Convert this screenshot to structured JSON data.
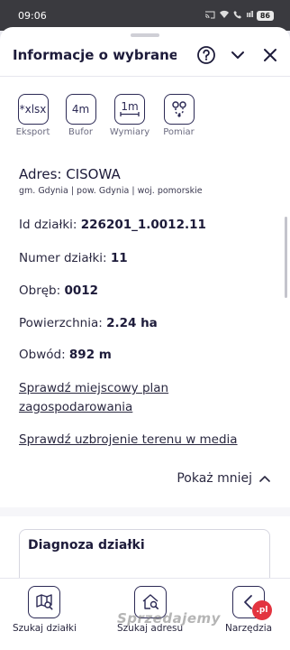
{
  "status_bar": {
    "time": "09:06",
    "battery": "86",
    "network": "ıııll"
  },
  "header": {
    "title": "Informacje o wybranej ..."
  },
  "tools": [
    {
      "glyph": "*xlsx",
      "label": "Eksport"
    },
    {
      "glyph": "4m",
      "label": "Bufor"
    },
    {
      "glyph": "1m",
      "label": "Wymiary"
    },
    {
      "glyph": "",
      "label": "Pomiar"
    }
  ],
  "address": {
    "main": "Adres: CISOWA",
    "sub": "gm. Gdynia | pow. Gdynia | woj. pomorskie"
  },
  "fields": [
    {
      "label": "Id działki: ",
      "value": "226201_1.0012.11"
    },
    {
      "label": "Numer działki: ",
      "value": "11"
    },
    {
      "label": "Obręb: ",
      "value": "0012"
    },
    {
      "label": "Powierzchnia: ",
      "value": "2.24 ha"
    },
    {
      "label": "Obwód: ",
      "value": "892 m"
    }
  ],
  "links": {
    "plan_line1": "Sprawdź miejscowy plan",
    "plan_line2": "zagospodarowania",
    "media": "Sprawdź uzbrojenie terenu w media"
  },
  "show_less": "Pokaż mniej",
  "diagnosis": {
    "title": "Diagnoza działki"
  },
  "bottom_nav": [
    {
      "label": "Szukaj działki",
      "icon": "map-search-icon"
    },
    {
      "label": "Szukaj adresu",
      "icon": "home-search-icon"
    },
    {
      "label": "Narzędzia",
      "icon": "back-icon"
    }
  ],
  "watermark": {
    "text": "Sprzedajemy",
    "badge": ".pl"
  },
  "colors": {
    "accent": "#2c2a55",
    "text": "#1d1b3a",
    "status_bar": "#3a3a3f"
  }
}
